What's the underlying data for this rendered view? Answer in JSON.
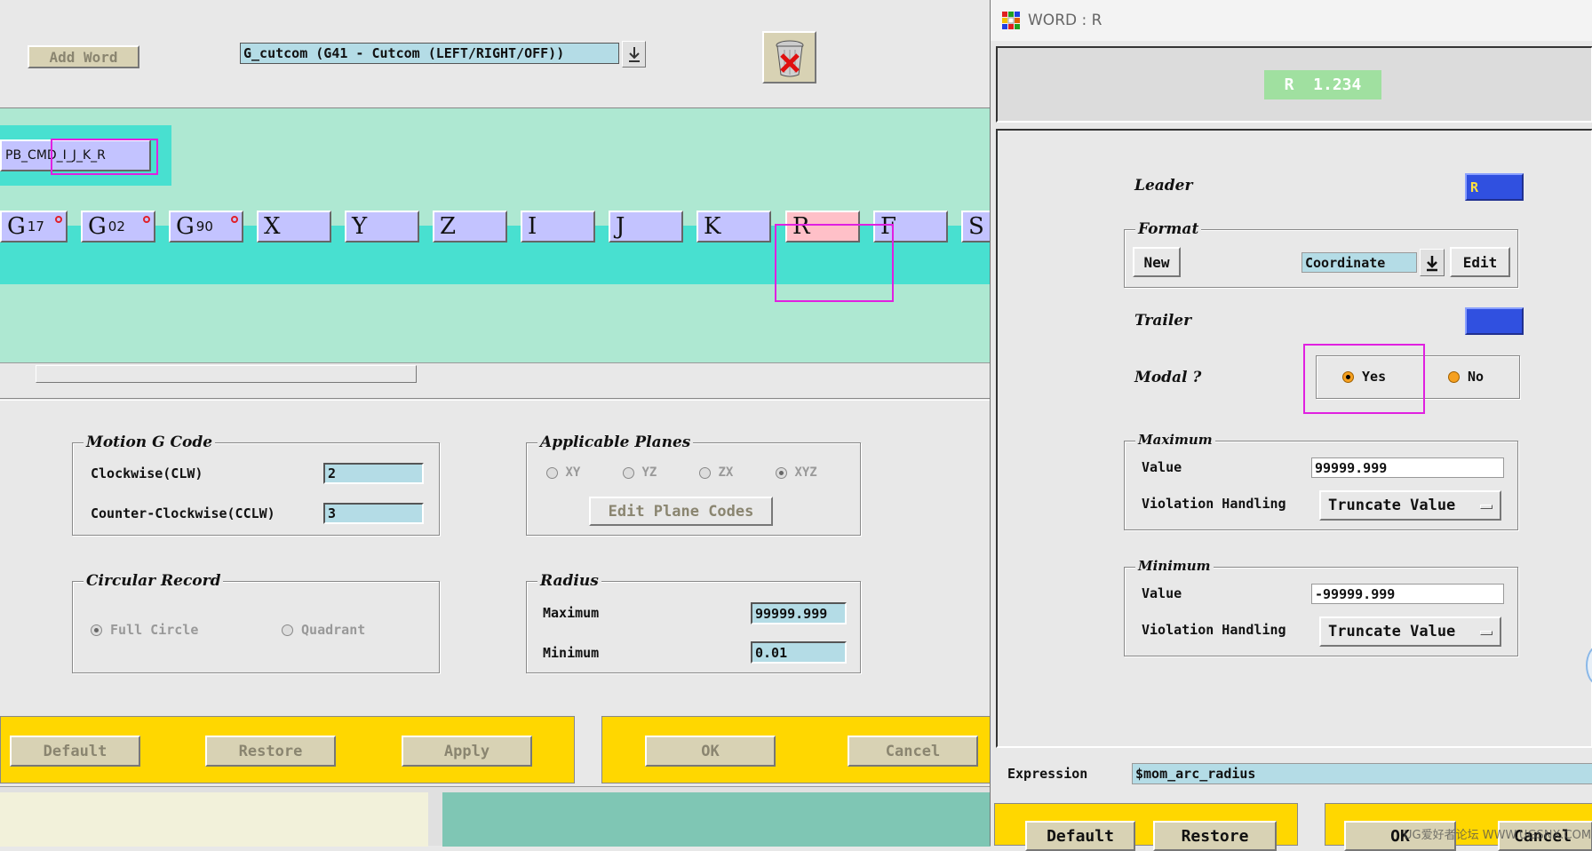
{
  "left": {
    "add_word": "Add Word",
    "word_select": "G_cutcom (G41 - Cutcom (LEFT/RIGHT/OFF))",
    "block_name": "PB_CMD_I_J_K_R",
    "words": [
      {
        "letter": "G",
        "sub": "17",
        "modal": true
      },
      {
        "letter": "G",
        "sub": "02",
        "modal": true
      },
      {
        "letter": "G",
        "sub": "90",
        "modal": true
      },
      {
        "letter": "X",
        "sub": "",
        "modal": false
      },
      {
        "letter": "Y",
        "sub": "",
        "modal": false
      },
      {
        "letter": "Z",
        "sub": "",
        "modal": false
      },
      {
        "letter": "I",
        "sub": "",
        "modal": false
      },
      {
        "letter": "J",
        "sub": "",
        "modal": false
      },
      {
        "letter": "K",
        "sub": "",
        "modal": false
      },
      {
        "letter": "R",
        "sub": "",
        "modal": false
      },
      {
        "letter": "F",
        "sub": "",
        "modal": false
      },
      {
        "letter": "S",
        "sub": "",
        "modal": false
      }
    ],
    "motion": {
      "title": "Motion G Code",
      "cw_label": "Clockwise(CLW)",
      "cw_value": "2",
      "ccw_label": "Counter-Clockwise(CCLW)",
      "ccw_value": "3"
    },
    "planes": {
      "title": "Applicable Planes",
      "options": [
        "XY",
        "YZ",
        "ZX",
        "XYZ"
      ],
      "selected": "XYZ",
      "edit_button": "Edit Plane Codes"
    },
    "circular": {
      "title": "Circular Record",
      "options": [
        "Full Circle",
        "Quadrant"
      ],
      "selected": "Full Circle"
    },
    "radius": {
      "title": "Radius",
      "max_label": "Maximum",
      "max_value": "99999.999",
      "min_label": "Minimum",
      "min_value": "0.01"
    },
    "buttons": {
      "default": "Default",
      "restore": "Restore",
      "apply": "Apply",
      "ok": "OK",
      "cancel": "Cancel"
    }
  },
  "right": {
    "window_title": "WORD : R",
    "preview": "R  1.234",
    "leader_label": "Leader",
    "leader_value": "R",
    "format_title": "Format",
    "format_new": "New",
    "format_value": "Coordinate",
    "format_edit": "Edit",
    "trailer_label": "Trailer",
    "modal_label": "Modal ?",
    "modal_yes": "Yes",
    "modal_no": "No",
    "modal_selected": "Yes",
    "max_title": "Maximum",
    "max_value_label": "Value",
    "max_value": "99999.999",
    "max_violation_label": "Violation Handling",
    "max_violation_value": "Truncate Value",
    "min_title": "Minimum",
    "min_value_label": "Value",
    "min_value": "-99999.999",
    "min_violation_label": "Violation Handling",
    "min_violation_value": "Truncate Value",
    "expression_label": "Expression",
    "expression_value": "$mom_arc_radius",
    "buttons": {
      "default": "Default",
      "restore": "Restore",
      "ok": "OK",
      "cancel": "Cancel"
    },
    "watermark": "UG爱好者论坛 WWW.UGSNX.COM"
  },
  "colors": {
    "teal_bg": "#aee8d2",
    "teal_strip": "#48e0d0",
    "word_box": "#c3c3ff",
    "selected_word": "#ffc0c8",
    "yellow": "#ffd700",
    "highlight": "#e020e0"
  }
}
